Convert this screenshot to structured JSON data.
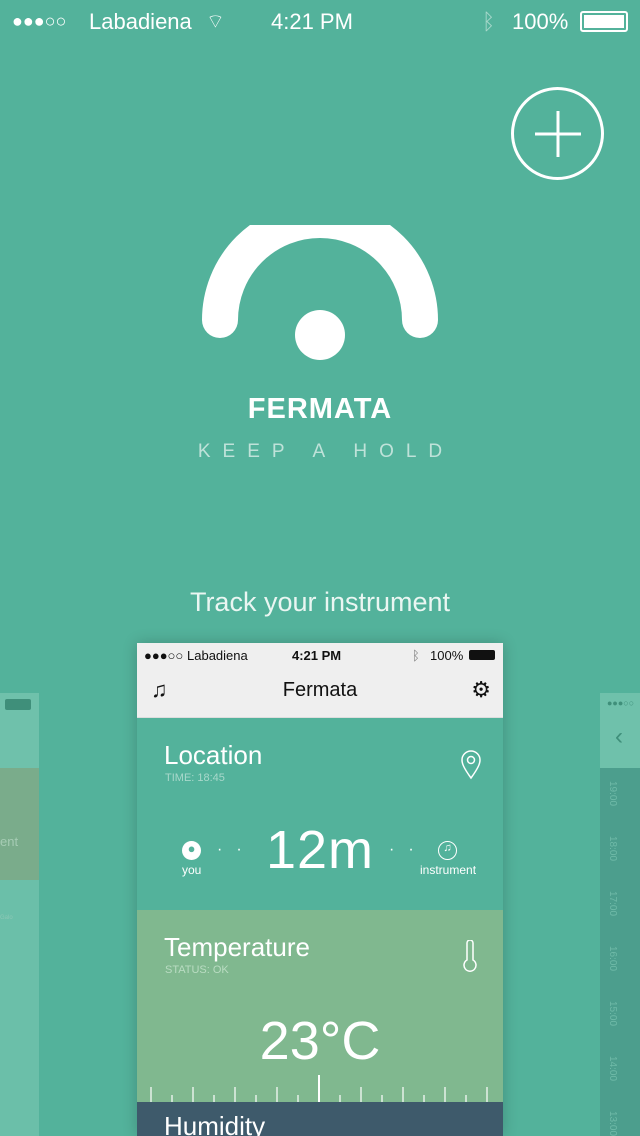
{
  "status_bar": {
    "signal": "●●●○○",
    "carrier": "Labadiena",
    "time": "4:21 PM",
    "battery": "100%"
  },
  "brand": {
    "name": "FERMATA",
    "tagline": "KEEP A HOLD"
  },
  "headline": "Track your instrument",
  "phone": {
    "status_bar": {
      "signal": "●●●○○",
      "carrier": "Labadiena",
      "time": "4:21 PM",
      "battery": "100%"
    },
    "title": "Fermata",
    "location": {
      "title": "Location",
      "subtitle": "TIME: 18:45",
      "distance": "12m",
      "you_label": "you",
      "instrument_label": "instrument"
    },
    "temperature": {
      "title": "Temperature",
      "subtitle": "STATUS: OK",
      "value": "23°C"
    },
    "humidity": {
      "title": "Humidity"
    }
  },
  "left_preview": {
    "text": "ent",
    "map_label": "Galo"
  },
  "right_preview": {
    "signal": "●●●○○",
    "times": [
      "19:00",
      "18:00",
      "17:00",
      "16:00",
      "15:00",
      "14:00",
      "13:00"
    ]
  },
  "colors": {
    "bg": "#53b29b",
    "temperature": "#80b88f",
    "humidity": "#3e5a6b"
  }
}
